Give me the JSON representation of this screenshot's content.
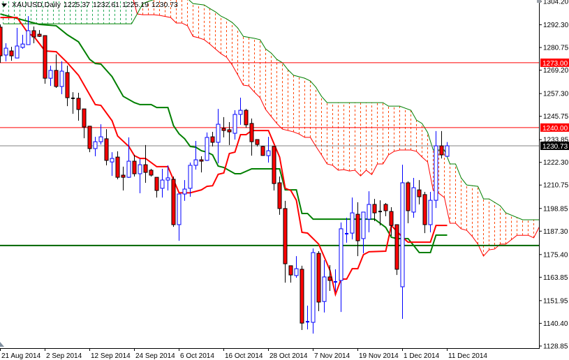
{
  "header": {
    "symbol": "XAUUSD,Daily",
    "open": "1225.37",
    "high": "1232.61",
    "low": "1225.19",
    "close": "1230.73"
  },
  "chart_data": {
    "type": "candlestick",
    "title": "XAUUSD,Daily",
    "ylim": [
      1128.85,
      1304.2
    ],
    "y_ticks": [
      "1304.20",
      "1292.30",
      "1280.75",
      "1269.20",
      "1257.30",
      "1245.75",
      "1233.85",
      "1222.30",
      "1210.75",
      "1198.85",
      "1187.30",
      "1175.40",
      "1163.85",
      "1151.95",
      "1140.40",
      "1128.85"
    ],
    "x_ticks": [
      {
        "bar": 0,
        "label": "21 Aug 2014"
      },
      {
        "bar": 8,
        "label": "2 Sep 2014"
      },
      {
        "bar": 16,
        "label": "12 Sep 2014"
      },
      {
        "bar": 24,
        "label": "24 Sep 2014"
      },
      {
        "bar": 32,
        "label": "6 Oct 2014"
      },
      {
        "bar": 40,
        "label": "16 Oct 2014"
      },
      {
        "bar": 48,
        "label": "28 Oct 2014"
      },
      {
        "bar": 56,
        "label": "7 Nov 2014"
      },
      {
        "bar": 64,
        "label": "19 Nov 2014"
      },
      {
        "bar": 72,
        "label": "1 Dec 2014"
      },
      {
        "bar": 80,
        "label": "11 Dec 2014"
      }
    ],
    "ohlc": [
      [
        1291.1,
        1292.5,
        1273.0,
        1276.5
      ],
      [
        1276.9,
        1282.9,
        1273.7,
        1280.4
      ],
      [
        1279.0,
        1281.1,
        1274.0,
        1276.5
      ],
      [
        1275.4,
        1290.7,
        1275.4,
        1281.5
      ],
      [
        1280.8,
        1287.2,
        1280.1,
        1282.5
      ],
      [
        1282.2,
        1296.7,
        1282.2,
        1289.3
      ],
      [
        1289.3,
        1291.4,
        1282.9,
        1286.1
      ],
      [
        1287.5,
        1289.6,
        1286.1,
        1286.4
      ],
      [
        1286.8,
        1286.8,
        1262.3,
        1265.1
      ],
      [
        1265.1,
        1271.5,
        1261.2,
        1269.1
      ],
      [
        1269.1,
        1277.2,
        1260.2,
        1260.9
      ],
      [
        1260.9,
        1273.7,
        1257.0,
        1268.7
      ],
      [
        1268.0,
        1271.5,
        1250.9,
        1255.2
      ],
      [
        1254.9,
        1258.0,
        1247.0,
        1254.8
      ],
      [
        1254.9,
        1257.7,
        1243.5,
        1249.2
      ],
      [
        1249.5,
        1249.5,
        1234.6,
        1240.3
      ],
      [
        1240.7,
        1240.7,
        1227.5,
        1229.3
      ],
      [
        1229.3,
        1235.3,
        1225.4,
        1232.8
      ],
      [
        1232.8,
        1241.7,
        1231.4,
        1235.3
      ],
      [
        1234.3,
        1239.2,
        1220.8,
        1223.3
      ],
      [
        1222.5,
        1227.5,
        1215.4,
        1224.3
      ],
      [
        1225.0,
        1227.9,
        1213.7,
        1214.7
      ],
      [
        1215.8,
        1220.1,
        1208.0,
        1214.7
      ],
      [
        1214.7,
        1235.0,
        1214.4,
        1222.9
      ],
      [
        1222.9,
        1226.1,
        1215.1,
        1216.5
      ],
      [
        1216.5,
        1224.0,
        1206.6,
        1221.1
      ],
      [
        1221.1,
        1231.1,
        1211.9,
        1217.2
      ],
      [
        1218.3,
        1219.0,
        1215.1,
        1215.8
      ],
      [
        1214.7,
        1214.7,
        1204.4,
        1208.0
      ],
      [
        1209.1,
        1219.0,
        1204.4,
        1213.3
      ],
      [
        1213.3,
        1220.8,
        1208.0,
        1214.4
      ],
      [
        1213.7,
        1215.1,
        1189.5,
        1190.6
      ],
      [
        1190.6,
        1206.2,
        1182.4,
        1206.2
      ],
      [
        1206.2,
        1213.3,
        1202.7,
        1208.7
      ],
      [
        1209.1,
        1222.2,
        1204.8,
        1220.8
      ],
      [
        1220.8,
        1233.2,
        1218.6,
        1223.6
      ],
      [
        1223.6,
        1225.4,
        1217.2,
        1222.9
      ],
      [
        1223.3,
        1237.5,
        1223.0,
        1235.0
      ],
      [
        1235.3,
        1237.8,
        1230.4,
        1232.5
      ],
      [
        1232.5,
        1249.5,
        1221.8,
        1241.7
      ],
      [
        1239.6,
        1245.3,
        1235.0,
        1238.5
      ],
      [
        1238.9,
        1242.8,
        1231.1,
        1237.8
      ],
      [
        1237.1,
        1248.8,
        1233.9,
        1246.7
      ],
      [
        1246.7,
        1255.2,
        1241.4,
        1248.8
      ],
      [
        1248.8,
        1249.5,
        1239.9,
        1241.4
      ],
      [
        1242.1,
        1244.6,
        1225.7,
        1232.8
      ],
      [
        1233.9,
        1233.9,
        1230.4,
        1231.4
      ],
      [
        1230.4,
        1230.7,
        1225.7,
        1225.8
      ],
      [
        1225.7,
        1235.3,
        1222.2,
        1228.2
      ],
      [
        1230.4,
        1230.4,
        1208.0,
        1211.5
      ],
      [
        1211.9,
        1215.1,
        1195.6,
        1198.8
      ],
      [
        1198.8,
        1202.7,
        1161.1,
        1170.7
      ],
      [
        1169.7,
        1169.7,
        1161.1,
        1165.0
      ],
      [
        1164.7,
        1174.6,
        1163.6,
        1168.2
      ],
      [
        1167.9,
        1169.7,
        1137.0,
        1140.5
      ],
      [
        1141.0,
        1149.4,
        1137.3,
        1141.2
      ],
      [
        1140.9,
        1178.5,
        1135.2,
        1176.4
      ],
      [
        1176.0,
        1177.1,
        1146.6,
        1151.2
      ],
      [
        1151.5,
        1172.5,
        1145.9,
        1164.0
      ],
      [
        1164.0,
        1170.0,
        1156.9,
        1162.2
      ],
      [
        1161.3,
        1167.9,
        1156.5,
        1161.5
      ],
      [
        1162.2,
        1191.7,
        1146.2,
        1188.5
      ],
      [
        1185.8,
        1194.1,
        1181.4,
        1186.0
      ],
      [
        1186.3,
        1204.4,
        1183.1,
        1196.6
      ],
      [
        1195.9,
        1202.0,
        1174.6,
        1182.4
      ],
      [
        1183.5,
        1197.0,
        1176.0,
        1197.0
      ],
      [
        1193.4,
        1207.6,
        1186.7,
        1200.9
      ],
      [
        1200.9,
        1203.7,
        1192.4,
        1196.6
      ],
      [
        1197.3,
        1203.0,
        1190.2,
        1197.3
      ],
      [
        1200.9,
        1201.6,
        1194.9,
        1197.7
      ],
      [
        1197.3,
        1199.5,
        1184.9,
        1190.2
      ],
      [
        1190.6,
        1190.6,
        1165.0,
        1167.9
      ],
      [
        1159.0,
        1221.1,
        1142.7,
        1211.9
      ],
      [
        1211.9,
        1212.6,
        1191.3,
        1197.7
      ],
      [
        1197.0,
        1214.4,
        1194.1,
        1209.4
      ],
      [
        1208.3,
        1213.3,
        1200.9,
        1204.8
      ],
      [
        1205.9,
        1207.3,
        1186.3,
        1190.6
      ],
      [
        1190.6,
        1207.3,
        1186.7,
        1203.0
      ],
      [
        1203.0,
        1238.2,
        1199.1,
        1230.7
      ],
      [
        1230.7,
        1238.2,
        1224.3,
        1226.1
      ],
      [
        1225.37,
        1232.61,
        1225.19,
        1230.73
      ]
    ],
    "tenkan": [
      [
        0,
        1296.0
      ],
      [
        3,
        1296.0
      ],
      [
        5,
        1287.9
      ],
      [
        6,
        1286.4
      ],
      [
        8,
        1279.0
      ],
      [
        10,
        1278.6
      ],
      [
        12,
        1273.0
      ],
      [
        14,
        1266.6
      ],
      [
        17,
        1251.7
      ],
      [
        18,
        1251.3
      ],
      [
        20,
        1243.5
      ],
      [
        21,
        1235.7
      ],
      [
        23,
        1230.4
      ],
      [
        24,
        1225.7
      ],
      [
        25,
        1224.3
      ],
      [
        26,
        1224.3
      ],
      [
        28,
        1220.1
      ],
      [
        30,
        1220.1
      ],
      [
        32,
        1206.8
      ],
      [
        34,
        1206.8
      ],
      [
        36,
        1208.3
      ],
      [
        37,
        1210.1
      ],
      [
        38,
        1210.4
      ],
      [
        39,
        1216.2
      ],
      [
        40,
        1216.9
      ],
      [
        41,
        1226.8
      ],
      [
        42,
        1227.5
      ],
      [
        43,
        1236.4
      ],
      [
        44,
        1236.4
      ],
      [
        45,
        1238.5
      ],
      [
        48,
        1238.5
      ],
      [
        50,
        1225.0
      ],
      [
        51,
        1209.1
      ],
      [
        52,
        1208.0
      ],
      [
        53,
        1203.0
      ],
      [
        54,
        1186.7
      ],
      [
        55,
        1186.3
      ],
      [
        57,
        1180.7
      ],
      [
        59,
        1167.5
      ],
      [
        60,
        1155.1
      ],
      [
        61,
        1162.9
      ],
      [
        62,
        1162.9
      ],
      [
        63,
        1168.2
      ],
      [
        64,
        1168.2
      ],
      [
        65,
        1175.3
      ],
      [
        66,
        1176.8
      ],
      [
        69,
        1177.1
      ],
      [
        70,
        1190.2
      ],
      [
        72,
        1184.2
      ],
      [
        73,
        1181.7
      ],
      [
        77,
        1181.7
      ],
      [
        78,
        1190.2
      ],
      [
        80,
        1190.2
      ]
    ],
    "kijun": [
      [
        0,
        1297.8
      ],
      [
        7,
        1292.5
      ],
      [
        10,
        1291.8
      ],
      [
        12,
        1287.2
      ],
      [
        14,
        1283.6
      ],
      [
        16,
        1274.7
      ],
      [
        17,
        1272.6
      ],
      [
        18,
        1272.3
      ],
      [
        20,
        1265.9
      ],
      [
        22,
        1255.9
      ],
      [
        24,
        1252.7
      ],
      [
        25,
        1251.7
      ],
      [
        27,
        1251.7
      ],
      [
        28,
        1250.2
      ],
      [
        30,
        1250.2
      ],
      [
        31,
        1241.0
      ],
      [
        32,
        1236.8
      ],
      [
        33,
        1234.3
      ],
      [
        34,
        1230.4
      ],
      [
        35,
        1230.0
      ],
      [
        36,
        1228.2
      ],
      [
        37,
        1227.5
      ],
      [
        38,
        1226.1
      ],
      [
        39,
        1220.4
      ],
      [
        40,
        1219.7
      ],
      [
        42,
        1216.5
      ],
      [
        43,
        1216.5
      ],
      [
        45,
        1219.0
      ],
      [
        50,
        1219.0
      ],
      [
        51,
        1208.3
      ],
      [
        53,
        1208.3
      ],
      [
        54,
        1196.3
      ],
      [
        55,
        1196.3
      ],
      [
        56,
        1193.4
      ],
      [
        67,
        1193.4
      ],
      [
        69,
        1189.2
      ],
      [
        70,
        1184.2
      ],
      [
        71,
        1183.5
      ],
      [
        73,
        1183.5
      ],
      [
        74,
        1180.0
      ],
      [
        75,
        1176.4
      ],
      [
        77,
        1176.4
      ],
      [
        78,
        1185.3
      ],
      [
        80,
        1185.3
      ]
    ],
    "senkou_a": [
      [
        0,
        1308.5
      ],
      [
        23,
        1308.5
      ],
      [
        24,
        1297.8
      ],
      [
        25,
        1297.4
      ],
      [
        27,
        1297.4
      ],
      [
        28,
        1297.1
      ],
      [
        30,
        1296.0
      ],
      [
        31,
        1293.2
      ],
      [
        32,
        1293.2
      ],
      [
        33,
        1291.8
      ],
      [
        34,
        1286.4
      ],
      [
        35,
        1285.7
      ],
      [
        36,
        1284.7
      ],
      [
        37,
        1282.5
      ],
      [
        38,
        1280.0
      ],
      [
        39,
        1277.6
      ],
      [
        40,
        1275.8
      ],
      [
        41,
        1271.9
      ],
      [
        42,
        1266.9
      ],
      [
        43,
        1261.6
      ],
      [
        44,
        1261.2
      ],
      [
        45,
        1258.0
      ],
      [
        46,
        1255.2
      ],
      [
        47,
        1249.2
      ],
      [
        48,
        1245.6
      ],
      [
        49,
        1242.1
      ],
      [
        50,
        1239.2
      ],
      [
        52,
        1237.8
      ],
      [
        53,
        1236.7
      ],
      [
        54,
        1235.0
      ],
      [
        55,
        1235.0
      ],
      [
        56,
        1230.4
      ],
      [
        57,
        1226.1
      ],
      [
        58,
        1221.5
      ],
      [
        59,
        1220.8
      ],
      [
        60,
        1218.3
      ],
      [
        61,
        1218.6
      ],
      [
        62,
        1217.9
      ],
      [
        63,
        1218.3
      ],
      [
        64,
        1215.4
      ],
      [
        65,
        1218.3
      ],
      [
        66,
        1216.1
      ],
      [
        67,
        1221.5
      ],
      [
        68,
        1221.5
      ],
      [
        69,
        1226.1
      ],
      [
        70,
        1227.9
      ],
      [
        71,
        1228.6
      ],
      [
        73,
        1228.6
      ],
      [
        74,
        1227.9
      ],
      [
        75,
        1225.0
      ],
      [
        76,
        1222.5
      ],
      [
        77,
        1208.0
      ],
      [
        78,
        1206.6
      ],
      [
        79,
        1204.4
      ],
      [
        80,
        1191.3
      ],
      [
        81,
        1191.3
      ],
      [
        82,
        1188.5
      ],
      [
        83,
        1187.7
      ],
      [
        84,
        1184.6
      ],
      [
        85,
        1180.7
      ],
      [
        86,
        1174.6
      ],
      [
        87,
        1177.8
      ],
      [
        88,
        1178.2
      ],
      [
        89,
        1180.7
      ],
      [
        90,
        1180.7
      ],
      [
        92,
        1185.2
      ],
      [
        94,
        1185.2
      ],
      [
        95,
        1183.9
      ],
      [
        96,
        1189.5
      ]
    ],
    "senkou_b": [
      [
        0,
        1292.8
      ],
      [
        23,
        1292.8
      ],
      [
        24,
        1297.8
      ],
      [
        25,
        1303.1
      ],
      [
        26,
        1304.2
      ],
      [
        28,
        1306.0
      ],
      [
        30,
        1306.7
      ],
      [
        33,
        1305.6
      ],
      [
        34,
        1303.1
      ],
      [
        36,
        1302.4
      ],
      [
        37,
        1300.6
      ],
      [
        38,
        1298.9
      ],
      [
        39,
        1296.7
      ],
      [
        40,
        1295.3
      ],
      [
        41,
        1293.5
      ],
      [
        42,
        1290.7
      ],
      [
        43,
        1286.4
      ],
      [
        45,
        1285.4
      ],
      [
        46,
        1284.7
      ],
      [
        47,
        1280.0
      ],
      [
        48,
        1277.9
      ],
      [
        49,
        1274.7
      ],
      [
        50,
        1273.0
      ],
      [
        51,
        1269.4
      ],
      [
        52,
        1266.6
      ],
      [
        54,
        1265.1
      ],
      [
        55,
        1263.7
      ],
      [
        56,
        1260.5
      ],
      [
        57,
        1255.9
      ],
      [
        58,
        1252.7
      ],
      [
        68,
        1252.7
      ],
      [
        69,
        1250.9
      ],
      [
        71,
        1250.9
      ],
      [
        73,
        1248.8
      ],
      [
        74,
        1243.8
      ],
      [
        75,
        1242.1
      ],
      [
        76,
        1237.5
      ],
      [
        77,
        1228.6
      ],
      [
        79,
        1228.6
      ],
      [
        80,
        1221.5
      ],
      [
        81,
        1221.5
      ],
      [
        82,
        1214.4
      ],
      [
        83,
        1210.8
      ],
      [
        85,
        1210.1
      ],
      [
        86,
        1203.7
      ],
      [
        87,
        1203.7
      ],
      [
        89,
        1200.2
      ],
      [
        90,
        1196.6
      ],
      [
        93,
        1193.1
      ],
      [
        96,
        1193.1
      ]
    ],
    "hlines": [
      {
        "price": 1273.0,
        "label": "1273.00",
        "color": "#ff0000",
        "tag": "#ff0000"
      },
      {
        "price": 1240.0,
        "label": "1240.00",
        "color": "#ff0000",
        "tag": "#ff0000"
      },
      {
        "price": 1230.73,
        "label": "1230.73",
        "color": "#808080",
        "tag": "#000000"
      },
      {
        "price": 1180.0,
        "label": "",
        "color": "#006400",
        "tag": ""
      }
    ],
    "colors": {
      "bull": "#0000ff",
      "bear_fill": "#ff0000",
      "bear_outline": "#000000",
      "tenkan": "#ff0000",
      "kijun": "#007f00",
      "cloud_bear": "#ff4500",
      "cloud_bull": "#22aa55",
      "span_a": "#ff0000",
      "span_b": "#008000"
    }
  }
}
